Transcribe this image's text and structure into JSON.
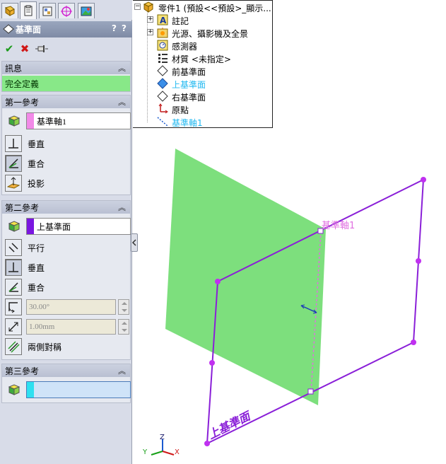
{
  "property_manager": {
    "title": "基準面",
    "help": "?",
    "help2": "?",
    "info_group": {
      "header": "訊息",
      "message": "完全定義"
    },
    "first_ref": {
      "header": "第一參考",
      "selection": "基準軸1",
      "swatch_color": "#f28ae8",
      "options": [
        "垂直",
        "重合",
        "投影"
      ]
    },
    "second_ref": {
      "header": "第二參考",
      "selection": "上基準面",
      "swatch_color": "#7a16e0",
      "options": [
        "平行",
        "垂直",
        "重合"
      ],
      "angle_value": "30.00°",
      "distance_value": "1.00mm",
      "symmetric_label": "兩側對稱"
    },
    "third_ref": {
      "header": "第三參考",
      "swatch_color": "#2ee0f0"
    }
  },
  "feature_tree": {
    "items": [
      {
        "label": "零件1 (預設<<預設>_顯示...",
        "icon": "part-icon",
        "highlight": false
      },
      {
        "label": "註記",
        "icon": "annotations-icon",
        "highlight": false
      },
      {
        "label": "光源、攝影機及全景",
        "icon": "lights-icon",
        "highlight": false
      },
      {
        "label": "感測器",
        "icon": "sensor-icon",
        "highlight": false
      },
      {
        "label": "材質 <未指定>",
        "icon": "material-icon",
        "highlight": false
      },
      {
        "label": "前基準面",
        "icon": "plane-icon",
        "highlight": false
      },
      {
        "label": "上基準面",
        "icon": "plane-icon",
        "highlight": true
      },
      {
        "label": "右基準面",
        "icon": "plane-icon",
        "highlight": false
      },
      {
        "label": "原點",
        "icon": "origin-icon",
        "highlight": false
      },
      {
        "label": "基準軸1",
        "icon": "axis-icon",
        "highlight": true
      }
    ]
  },
  "viewport": {
    "axis_label": "基準軸1",
    "plane_label": "上基準面",
    "triad": {
      "x": "X",
      "y": "Y",
      "z": "Z"
    },
    "colors": {
      "preview_plane": "#6fdc6f",
      "selection": "#8a1fd8",
      "axis_label": "#e070e0",
      "highlight_text": "#20b8f0"
    }
  }
}
